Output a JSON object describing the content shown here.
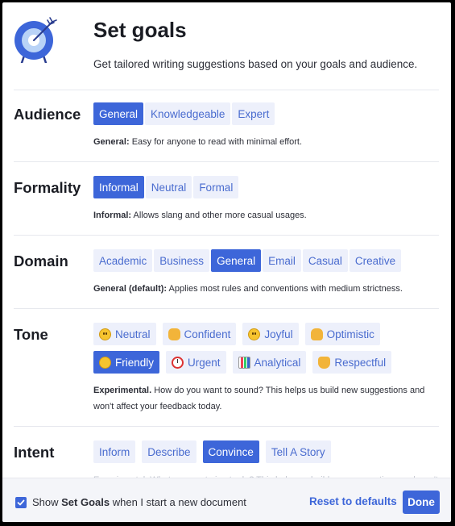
{
  "header": {
    "title": "Set goals",
    "subtitle": "Get tailored writing suggestions based on your goals and audience.",
    "logo_icon": "target-with-arrow-icon"
  },
  "audience": {
    "title": "Audience",
    "options": [
      "General",
      "Knowledgeable",
      "Expert"
    ],
    "selected": "General",
    "desc_label": "General:",
    "desc_text": " Easy for anyone to read with minimal effort."
  },
  "formality": {
    "title": "Formality",
    "options": [
      "Informal",
      "Neutral",
      "Formal"
    ],
    "selected": "Informal",
    "desc_label": "Informal:",
    "desc_text": " Allows slang and other more casual usages."
  },
  "domain": {
    "title": "Domain",
    "options": [
      "Academic",
      "Business",
      "General",
      "Email",
      "Casual",
      "Creative"
    ],
    "selected": "General",
    "desc_label": "General (default):",
    "desc_text": " Applies most rules and conventions with medium strictness."
  },
  "tone": {
    "title": "Tone",
    "row1": [
      {
        "label": "Neutral",
        "icon": "neutral-face-emoji"
      },
      {
        "label": "Confident",
        "icon": "handshake-emoji"
      },
      {
        "label": "Joyful",
        "icon": "smiling-face-emoji"
      },
      {
        "label": "Optimistic",
        "icon": "victory-hand-emoji"
      }
    ],
    "row2": [
      {
        "label": "Friendly",
        "icon": "hugging-face-emoji"
      },
      {
        "label": "Urgent",
        "icon": "alarm-clock-emoji"
      },
      {
        "label": "Analytical",
        "icon": "bar-chart-emoji"
      },
      {
        "label": "Respectful",
        "icon": "raising-hands-emoji"
      }
    ],
    "selected": "Friendly",
    "desc_label": "Experimental.",
    "desc_line1": " How do you want to sound? This helps us build new suggestions and",
    "desc_line2": "won't affect your feedback today."
  },
  "intent": {
    "title": "Intent",
    "options": [
      "Inform",
      "Describe",
      "Convince",
      "Tell A Story"
    ],
    "selected": "Convince",
    "partial_desc": "Experimental. What are you trying to do? This helps us build new suggestions and won't"
  },
  "footer": {
    "checkbox_checked": true,
    "text_before": "Show ",
    "text_strong": "Set Goals",
    "text_after": " when I start a new document",
    "reset_label": "Reset to defaults",
    "done_label": "Done"
  },
  "colors": {
    "accent": "#3d66d9",
    "option_bg": "#edf0fb",
    "option_text": "#4a6ccf"
  }
}
